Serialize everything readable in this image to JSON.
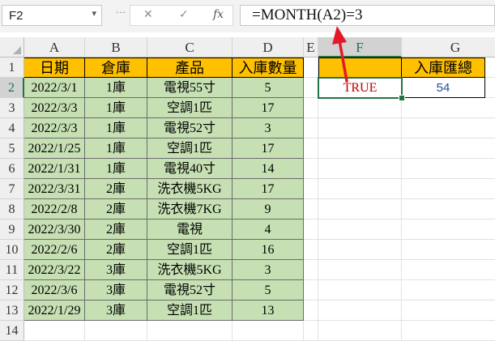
{
  "formula_bar": {
    "name_box": "F2",
    "name_box_arrow": "▾",
    "cancel_symbol": "✕",
    "confirm_symbol": "✓",
    "fx_label": "fx",
    "formula": "=MONTH(A2)=3"
  },
  "columns": [
    "A",
    "B",
    "C",
    "D",
    "E",
    "F",
    "G"
  ],
  "rows": [
    "1",
    "2",
    "3",
    "4",
    "5",
    "6",
    "7",
    "8",
    "9",
    "10",
    "11",
    "12",
    "13",
    "14"
  ],
  "table": {
    "headers": [
      "日期",
      "倉庫",
      "產品",
      "入庫數量"
    ],
    "rows": [
      [
        "2022/3/1",
        "1庫",
        "電視55寸",
        "5"
      ],
      [
        "2022/3/3",
        "1庫",
        "空調1匹",
        "17"
      ],
      [
        "2022/3/3",
        "1庫",
        "電視52寸",
        "3"
      ],
      [
        "2022/1/25",
        "1庫",
        "空調1匹",
        "17"
      ],
      [
        "2022/1/31",
        "1庫",
        "電視40寸",
        "14"
      ],
      [
        "2022/3/31",
        "2庫",
        "洗衣機5KG",
        "17"
      ],
      [
        "2022/2/8",
        "2庫",
        "洗衣機7KG",
        "9"
      ],
      [
        "2022/3/30",
        "2庫",
        "電視",
        "4"
      ],
      [
        "2022/2/6",
        "2庫",
        "空調1匹",
        "16"
      ],
      [
        "2022/3/22",
        "3庫",
        "洗衣機5KG",
        "3"
      ],
      [
        "2022/3/6",
        "3庫",
        "電視52寸",
        "5"
      ],
      [
        "2022/1/29",
        "3庫",
        "空調1匹",
        "13"
      ]
    ]
  },
  "criteria": {
    "f1": "",
    "g1": "入庫匯總",
    "f2": "TRUE",
    "g2": "54"
  },
  "colors": {
    "header_fill": "#ffc000",
    "data_fill": "#c6e0b4",
    "selection": "#217346",
    "arrow": "#e3192a",
    "true_text": "#c00000",
    "result_text": "#1f4e99"
  }
}
